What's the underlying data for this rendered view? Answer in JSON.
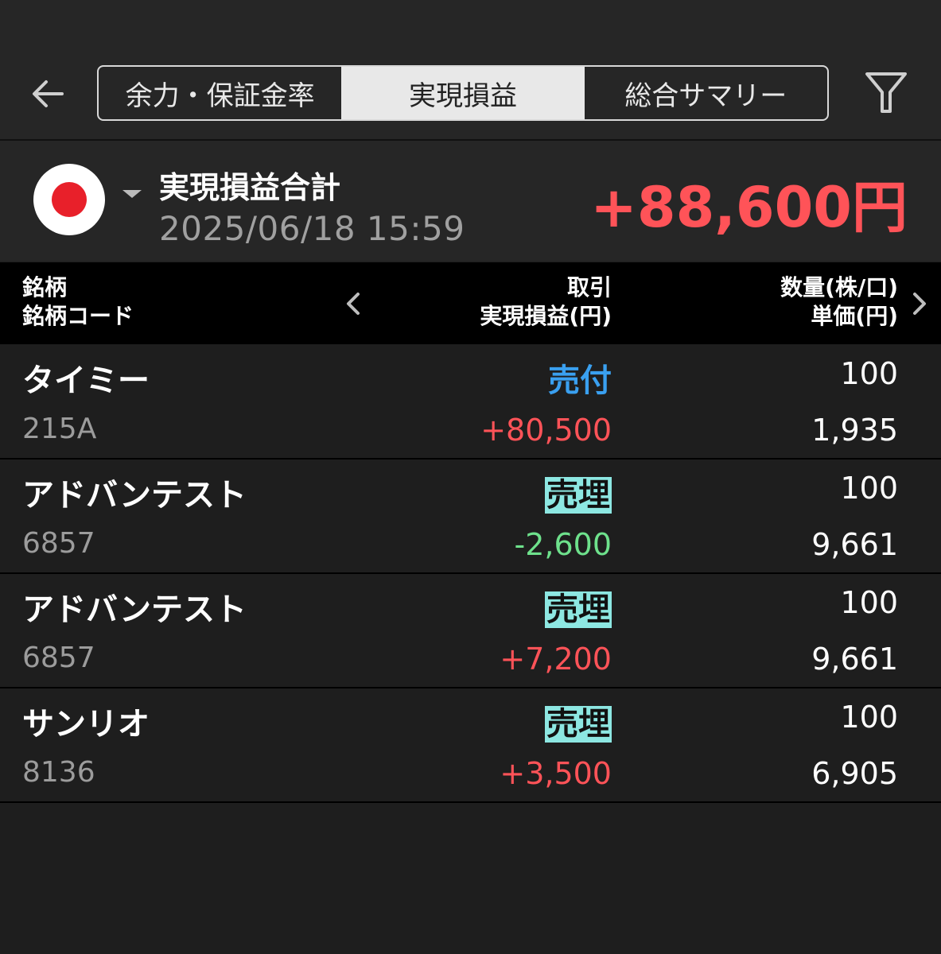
{
  "tabs": [
    {
      "label": "余力・保証金率"
    },
    {
      "label": "実現損益"
    },
    {
      "label": "総合サマリー"
    }
  ],
  "active_tab": 1,
  "summary": {
    "title": "実現損益合計",
    "datetime": "2025/06/18  15:59",
    "total": "+88,600円"
  },
  "table": {
    "col1": {
      "line1": "銘柄",
      "line2": "銘柄コード"
    },
    "col2": {
      "line1": "取引",
      "line2": "実現損益(円)"
    },
    "col3": {
      "line1": "数量(株/口)",
      "line2": "単価(円)"
    }
  },
  "rows": [
    {
      "name": "タイミー",
      "code": "215A",
      "trade": "売付",
      "pnl": "+80,500",
      "qty": "100",
      "price": "1,935"
    },
    {
      "name": "アドバンテスト",
      "code": "6857",
      "trade": "売埋",
      "pnl": "-2,600",
      "qty": "100",
      "price": "9,661"
    },
    {
      "name": "アドバンテスト",
      "code": "6857",
      "trade": "売埋",
      "pnl": "+7,200",
      "qty": "100",
      "price": "9,661"
    },
    {
      "name": "サンリオ",
      "code": "8136",
      "trade": "売埋",
      "pnl": "+3,500",
      "qty": "100",
      "price": "6,905"
    }
  ],
  "colors": {
    "positive": "#ff5358",
    "negative": "#6ee18c",
    "buy": "#3aa0f0",
    "sell_highlight": "#8de7e2"
  },
  "icons": [
    "arrow-left-icon",
    "filter-icon",
    "japan-flag-icon",
    "chevron-left-icon",
    "chevron-right-icon"
  ]
}
